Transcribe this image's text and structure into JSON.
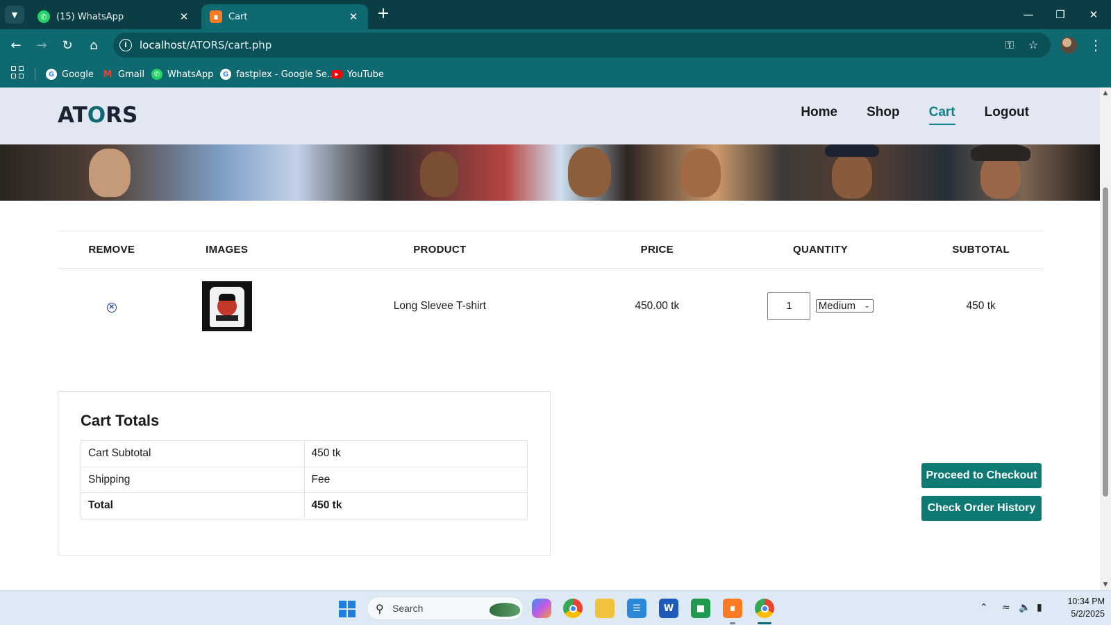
{
  "browser": {
    "tabs": [
      {
        "title": "(15) WhatsApp",
        "active": false
      },
      {
        "title": "Cart",
        "active": true
      }
    ],
    "url_host": "localhost",
    "url_path": "/ATORS/cart.php",
    "bookmarks": [
      "Google",
      "Gmail",
      "WhatsApp",
      "fastplex - Google Se...",
      "YouTube"
    ]
  },
  "site": {
    "logo": "ATORS",
    "nav": [
      "Home",
      "Shop",
      "Cart",
      "Logout"
    ],
    "active_nav": "Cart"
  },
  "cart": {
    "headers": [
      "REMOVE",
      "IMAGES",
      "PRODUCT",
      "PRICE",
      "QUANTITY",
      "SUBTOTAL"
    ],
    "items": [
      {
        "product": "Long Slevee T-shirt",
        "price": "450.00 tk",
        "quantity": "1",
        "size": "Medium",
        "subtotal": "450 tk"
      }
    ]
  },
  "totals": {
    "title": "Cart Totals",
    "rows": [
      {
        "label": "Cart Subtotal",
        "value": "450 tk"
      },
      {
        "label": "Shipping",
        "value": "Fee"
      },
      {
        "label": "Total",
        "value": "450 tk"
      }
    ]
  },
  "actions": {
    "checkout": "Proceed to Checkout",
    "history": "Check Order History"
  },
  "taskbar": {
    "search_placeholder": "Search",
    "time": "10:34 PM",
    "date": "5/2/2025"
  },
  "colors": {
    "chrome_dark": "#0b3d44",
    "chrome": "#0f6970",
    "accent": "#138089",
    "button": "#0f7a73",
    "header_bg": "#e3e6f3"
  }
}
